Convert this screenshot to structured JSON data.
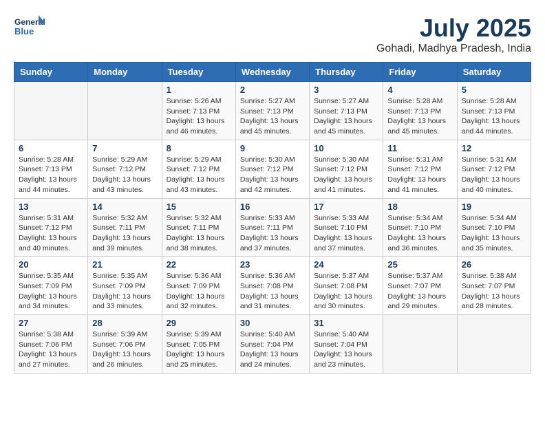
{
  "header": {
    "logo_line1": "General",
    "logo_line2": "Blue",
    "month": "July 2025",
    "location": "Gohadi, Madhya Pradesh, India"
  },
  "weekdays": [
    "Sunday",
    "Monday",
    "Tuesday",
    "Wednesday",
    "Thursday",
    "Friday",
    "Saturday"
  ],
  "weeks": [
    [
      {
        "day": "",
        "info": ""
      },
      {
        "day": "",
        "info": ""
      },
      {
        "day": "1",
        "info": "Sunrise: 5:26 AM\nSunset: 7:13 PM\nDaylight: 13 hours and 46 minutes."
      },
      {
        "day": "2",
        "info": "Sunrise: 5:27 AM\nSunset: 7:13 PM\nDaylight: 13 hours and 45 minutes."
      },
      {
        "day": "3",
        "info": "Sunrise: 5:27 AM\nSunset: 7:13 PM\nDaylight: 13 hours and 45 minutes."
      },
      {
        "day": "4",
        "info": "Sunrise: 5:28 AM\nSunset: 7:13 PM\nDaylight: 13 hours and 45 minutes."
      },
      {
        "day": "5",
        "info": "Sunrise: 5:28 AM\nSunset: 7:13 PM\nDaylight: 13 hours and 44 minutes."
      }
    ],
    [
      {
        "day": "6",
        "info": "Sunrise: 5:28 AM\nSunset: 7:13 PM\nDaylight: 13 hours and 44 minutes."
      },
      {
        "day": "7",
        "info": "Sunrise: 5:29 AM\nSunset: 7:12 PM\nDaylight: 13 hours and 43 minutes."
      },
      {
        "day": "8",
        "info": "Sunrise: 5:29 AM\nSunset: 7:12 PM\nDaylight: 13 hours and 43 minutes."
      },
      {
        "day": "9",
        "info": "Sunrise: 5:30 AM\nSunset: 7:12 PM\nDaylight: 13 hours and 42 minutes."
      },
      {
        "day": "10",
        "info": "Sunrise: 5:30 AM\nSunset: 7:12 PM\nDaylight: 13 hours and 41 minutes."
      },
      {
        "day": "11",
        "info": "Sunrise: 5:31 AM\nSunset: 7:12 PM\nDaylight: 13 hours and 41 minutes."
      },
      {
        "day": "12",
        "info": "Sunrise: 5:31 AM\nSunset: 7:12 PM\nDaylight: 13 hours and 40 minutes."
      }
    ],
    [
      {
        "day": "13",
        "info": "Sunrise: 5:31 AM\nSunset: 7:12 PM\nDaylight: 13 hours and 40 minutes."
      },
      {
        "day": "14",
        "info": "Sunrise: 5:32 AM\nSunset: 7:11 PM\nDaylight: 13 hours and 39 minutes."
      },
      {
        "day": "15",
        "info": "Sunrise: 5:32 AM\nSunset: 7:11 PM\nDaylight: 13 hours and 38 minutes."
      },
      {
        "day": "16",
        "info": "Sunrise: 5:33 AM\nSunset: 7:11 PM\nDaylight: 13 hours and 37 minutes."
      },
      {
        "day": "17",
        "info": "Sunrise: 5:33 AM\nSunset: 7:10 PM\nDaylight: 13 hours and 37 minutes."
      },
      {
        "day": "18",
        "info": "Sunrise: 5:34 AM\nSunset: 7:10 PM\nDaylight: 13 hours and 36 minutes."
      },
      {
        "day": "19",
        "info": "Sunrise: 5:34 AM\nSunset: 7:10 PM\nDaylight: 13 hours and 35 minutes."
      }
    ],
    [
      {
        "day": "20",
        "info": "Sunrise: 5:35 AM\nSunset: 7:09 PM\nDaylight: 13 hours and 34 minutes."
      },
      {
        "day": "21",
        "info": "Sunrise: 5:35 AM\nSunset: 7:09 PM\nDaylight: 13 hours and 33 minutes."
      },
      {
        "day": "22",
        "info": "Sunrise: 5:36 AM\nSunset: 7:09 PM\nDaylight: 13 hours and 32 minutes."
      },
      {
        "day": "23",
        "info": "Sunrise: 5:36 AM\nSunset: 7:08 PM\nDaylight: 13 hours and 31 minutes."
      },
      {
        "day": "24",
        "info": "Sunrise: 5:37 AM\nSunset: 7:08 PM\nDaylight: 13 hours and 30 minutes."
      },
      {
        "day": "25",
        "info": "Sunrise: 5:37 AM\nSunset: 7:07 PM\nDaylight: 13 hours and 29 minutes."
      },
      {
        "day": "26",
        "info": "Sunrise: 5:38 AM\nSunset: 7:07 PM\nDaylight: 13 hours and 28 minutes."
      }
    ],
    [
      {
        "day": "27",
        "info": "Sunrise: 5:38 AM\nSunset: 7:06 PM\nDaylight: 13 hours and 27 minutes."
      },
      {
        "day": "28",
        "info": "Sunrise: 5:39 AM\nSunset: 7:06 PM\nDaylight: 13 hours and 26 minutes."
      },
      {
        "day": "29",
        "info": "Sunrise: 5:39 AM\nSunset: 7:05 PM\nDaylight: 13 hours and 25 minutes."
      },
      {
        "day": "30",
        "info": "Sunrise: 5:40 AM\nSunset: 7:04 PM\nDaylight: 13 hours and 24 minutes."
      },
      {
        "day": "31",
        "info": "Sunrise: 5:40 AM\nSunset: 7:04 PM\nDaylight: 13 hours and 23 minutes."
      },
      {
        "day": "",
        "info": ""
      },
      {
        "day": "",
        "info": ""
      }
    ]
  ]
}
